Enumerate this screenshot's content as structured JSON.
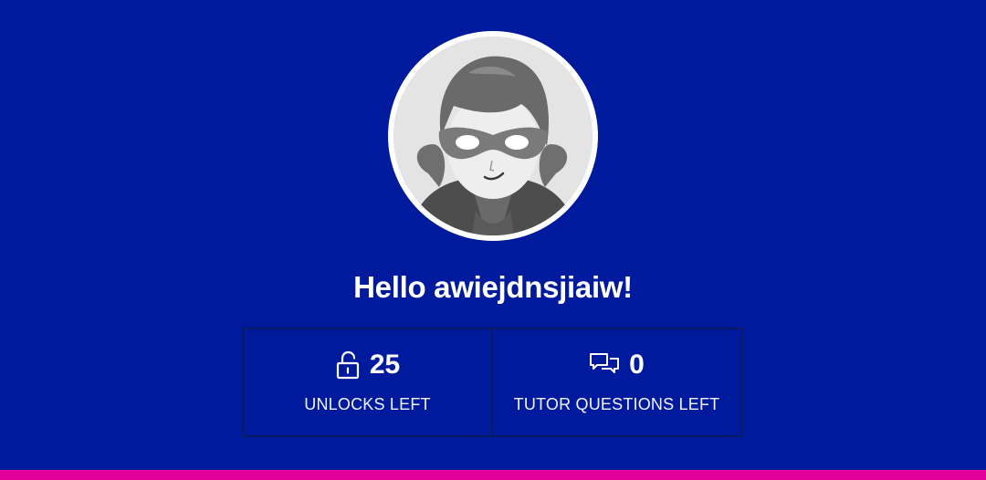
{
  "profile": {
    "greeting": "Hello awiejdnsjiaiw!",
    "avatar_icon": "masked-character-avatar"
  },
  "stats": {
    "unlocks": {
      "icon": "unlock-icon",
      "value": "25",
      "label": "UNLOCKS LEFT"
    },
    "tutor_questions": {
      "icon": "chat-bubbles-icon",
      "value": "0",
      "label": "TUTOR QUESTIONS LEFT"
    }
  },
  "colors": {
    "background": "#001a9e",
    "border": "#0b1a5c",
    "text": "#ffffff",
    "accent_bar": "#e2009a"
  }
}
